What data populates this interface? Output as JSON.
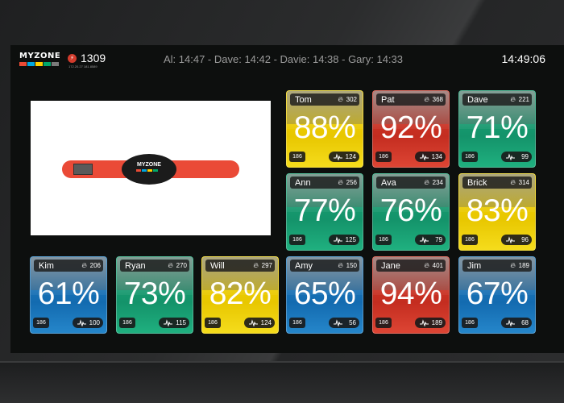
{
  "header": {
    "logo_text": "MYZONE",
    "hub_code": "1309",
    "hub_ip": "172.20.27 181.8589",
    "ticker": "Al: 14:47 - Dave: 14:42 - Davie: 14:38 - Gary: 14:33",
    "clock": "14:49:06"
  },
  "promo": {
    "pod_logo": "MYZONE"
  },
  "colors": {
    "yellow": "#f3d400",
    "red": "#d93a2a",
    "green": "#1aa97a",
    "blue": "#1f7fc4",
    "logo_bars": [
      "#e94b35",
      "#00a8e1",
      "#ffd100",
      "#00a86b",
      "#7a7a7a"
    ]
  },
  "tiles": [
    {
      "name": "Tom",
      "calories": "302",
      "percent": "88%",
      "heart": "186",
      "avg": "124",
      "zone": "yellow"
    },
    {
      "name": "Pat",
      "calories": "368",
      "percent": "92%",
      "heart": "186",
      "avg": "134",
      "zone": "red"
    },
    {
      "name": "Dave",
      "calories": "221",
      "percent": "71%",
      "heart": "186",
      "avg": "99",
      "zone": "green"
    },
    {
      "name": "Ann",
      "calories": "256",
      "percent": "77%",
      "heart": "186",
      "avg": "125",
      "zone": "green"
    },
    {
      "name": "Ava",
      "calories": "234",
      "percent": "76%",
      "heart": "186",
      "avg": "79",
      "zone": "green"
    },
    {
      "name": "Brick",
      "calories": "314",
      "percent": "83%",
      "heart": "186",
      "avg": "96",
      "zone": "yellow"
    },
    {
      "name": "Kim",
      "calories": "206",
      "percent": "61%",
      "heart": "186",
      "avg": "100",
      "zone": "blue"
    },
    {
      "name": "Ryan",
      "calories": "270",
      "percent": "73%",
      "heart": "186",
      "avg": "115",
      "zone": "green"
    },
    {
      "name": "Will",
      "calories": "297",
      "percent": "82%",
      "heart": "186",
      "avg": "124",
      "zone": "yellow"
    },
    {
      "name": "Amy",
      "calories": "150",
      "percent": "65%",
      "heart": "186",
      "avg": "56",
      "zone": "blue"
    },
    {
      "name": "Jane",
      "calories": "401",
      "percent": "94%",
      "heart": "186",
      "avg": "189",
      "zone": "red"
    },
    {
      "name": "Jim",
      "calories": "189",
      "percent": "67%",
      "heart": "186",
      "avg": "68",
      "zone": "blue"
    }
  ],
  "icons": {
    "flame": "flame-icon",
    "heart": "heart-icon",
    "pulse": "pulse-wave-icon",
    "hub": "hub-icon"
  }
}
